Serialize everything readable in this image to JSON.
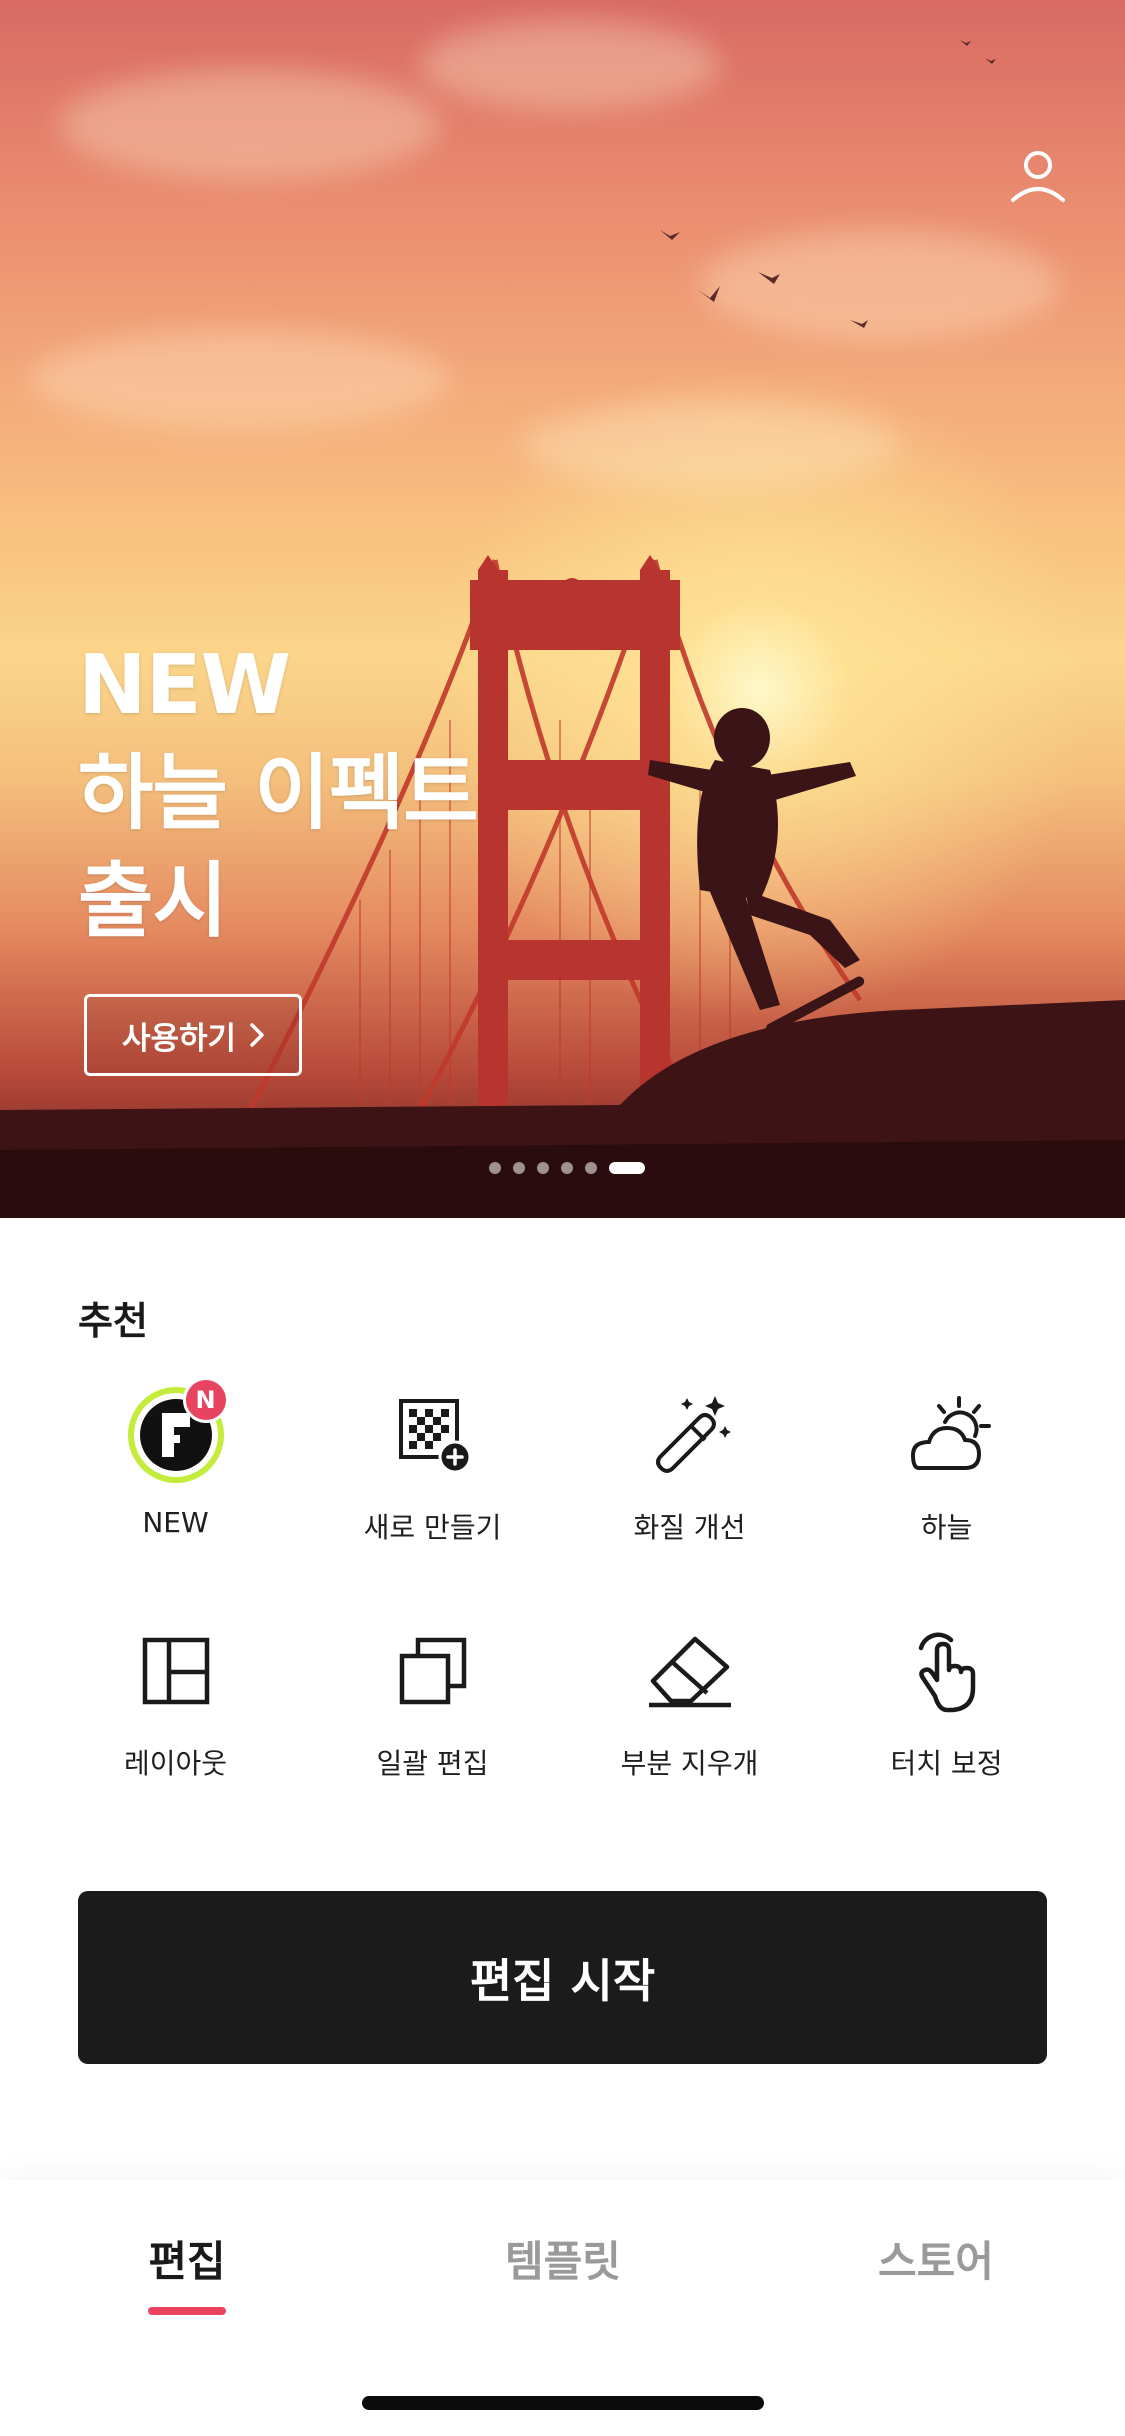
{
  "hero": {
    "title_lines": [
      "NEW",
      "하늘 이펙트",
      "출시"
    ],
    "cta_label": "사용하기",
    "carousel": {
      "total": 6,
      "active_index": 6
    }
  },
  "recommend": {
    "title": "추천",
    "items": [
      {
        "label": "NEW",
        "icon": "new-feature-icon",
        "badge": "N"
      },
      {
        "label": "새로 만들기",
        "icon": "new-canvas-icon"
      },
      {
        "label": "화질 개선",
        "icon": "magic-wand-icon"
      },
      {
        "label": "하늘",
        "icon": "sky-weather-icon"
      },
      {
        "label": "레이아웃",
        "icon": "layout-icon"
      },
      {
        "label": "일괄 편집",
        "icon": "batch-edit-icon"
      },
      {
        "label": "부분 지우개",
        "icon": "eraser-icon"
      },
      {
        "label": "터치 보정",
        "icon": "touch-icon"
      }
    ]
  },
  "start_button": {
    "label": "편집 시작"
  },
  "bottom_nav": {
    "tabs": [
      {
        "label": "편집",
        "active": true
      },
      {
        "label": "템플릿",
        "active": false
      },
      {
        "label": "스토어",
        "active": false
      }
    ]
  },
  "colors": {
    "accent": "#e8435f",
    "button_dark": "#1b1b1b",
    "text_primary": "#1a1a1a",
    "text_inactive": "#9a9a9a"
  }
}
